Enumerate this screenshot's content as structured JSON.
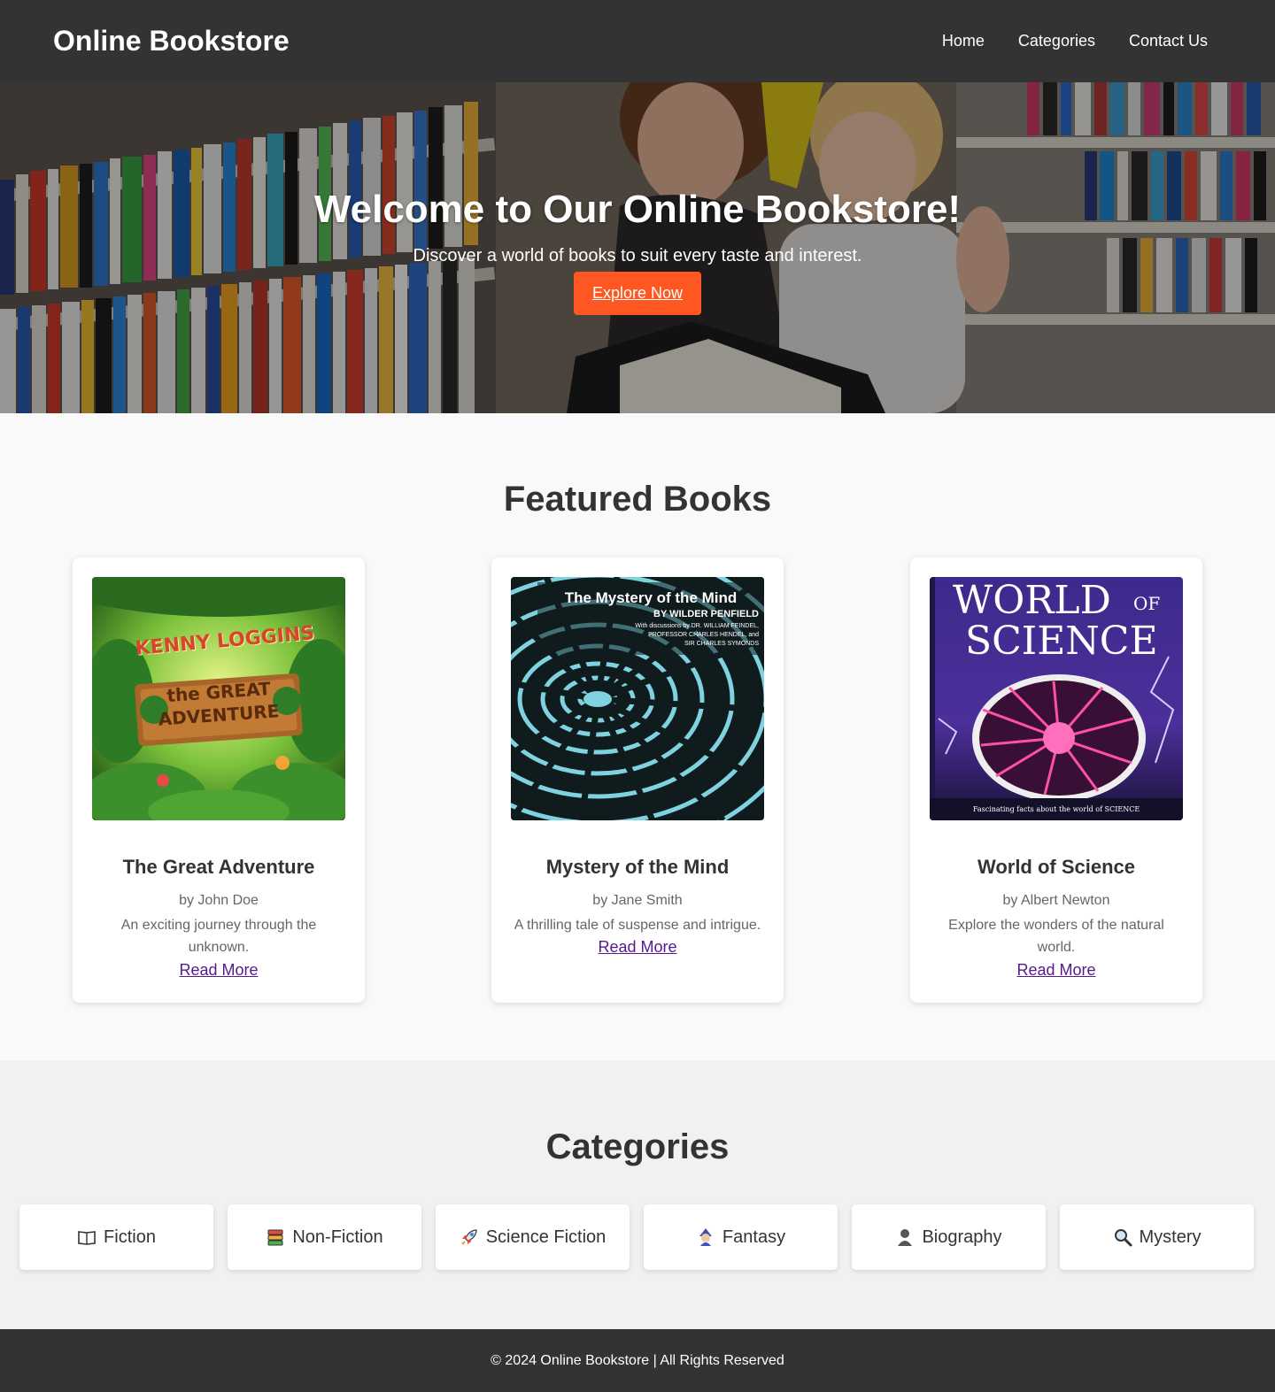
{
  "header": {
    "brand": "Online Bookstore",
    "nav": [
      {
        "label": "Home"
      },
      {
        "label": "Categories"
      },
      {
        "label": "Contact Us"
      }
    ]
  },
  "hero": {
    "title": "Welcome to Our Online Bookstore!",
    "subtitle": "Discover a world of books to suit every taste and interest.",
    "cta_label": "Explore Now"
  },
  "featured": {
    "heading": "Featured Books",
    "books": [
      {
        "title": "The Great Adventure",
        "author": "by John Doe",
        "description": "An exciting journey through the unknown.",
        "link_label": "Read More",
        "cover_text": [
          "KENNY LOGGINS",
          "the GREAT",
          "ADVENTURE"
        ]
      },
      {
        "title": "Mystery of the Mind",
        "author": "by Jane Smith",
        "description": "A thrilling tale of suspense and intrigue.",
        "link_label": "Read More",
        "cover_text": [
          "The Mystery of the Mind",
          "BY WILDER PENFIELD",
          "With discussions by DR. WILLIAM FEINDEL,",
          "PROFESSOR CHARLES HENDEL, and",
          "SIR CHARLES SYMONDS"
        ]
      },
      {
        "title": "World of Science",
        "author": "by Albert Newton",
        "description": "Explore the wonders of the natural world.",
        "link_label": "Read More",
        "cover_text": [
          "WORLD",
          "OF",
          "SCIENCE",
          "Fascinating facts about the world of SCIENCE"
        ]
      }
    ]
  },
  "categories": {
    "heading": "Categories",
    "items": [
      {
        "label": "Fiction",
        "icon": "open-book-icon"
      },
      {
        "label": "Non-Fiction",
        "icon": "books-stack-icon"
      },
      {
        "label": "Science Fiction",
        "icon": "rocket-icon"
      },
      {
        "label": "Fantasy",
        "icon": "wizard-icon"
      },
      {
        "label": "Biography",
        "icon": "person-silhouette-icon"
      },
      {
        "label": "Mystery",
        "icon": "magnifying-glass-icon"
      }
    ]
  },
  "footer": {
    "text": "© 2024 Online Bookstore | All Rights Reserved"
  },
  "colors": {
    "header_bg": "#333333",
    "cta": "#ff5722",
    "link": "#551a8b",
    "page_bg": "#f9f9f9",
    "categories_bg": "#f1f1f1"
  }
}
